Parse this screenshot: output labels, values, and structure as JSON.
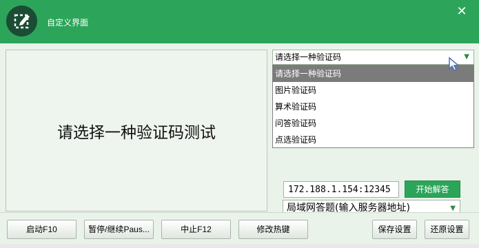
{
  "window": {
    "title": "自定义界面",
    "close_glyph": "✕",
    "accent_color": "#2ca55a",
    "dark_icon_bg": "#1b4d34",
    "icon": "edit-icon"
  },
  "preview": {
    "prompt": "请选择一种验证码测试"
  },
  "captcha_select": {
    "value": "请选择一种验证码",
    "arrow_glyph": "▼",
    "options": [
      "请选择一种验证码",
      "图片验证码",
      "算术验证码",
      "问答验证码",
      "点选验证码"
    ],
    "highlighted_index": 0
  },
  "lan": {
    "select_value": "局域网答题(输入服务器地址)",
    "arrow_glyph": "▼",
    "server_address": "172.188.1.154:12345",
    "start_button": "开始解答"
  },
  "toolbar": {
    "start": "启动F10",
    "pause": "暂停/继续Paus...",
    "stop": "中止F12",
    "hotkeys": "修改热键",
    "save": "保存设置",
    "restore": "还原设置"
  }
}
